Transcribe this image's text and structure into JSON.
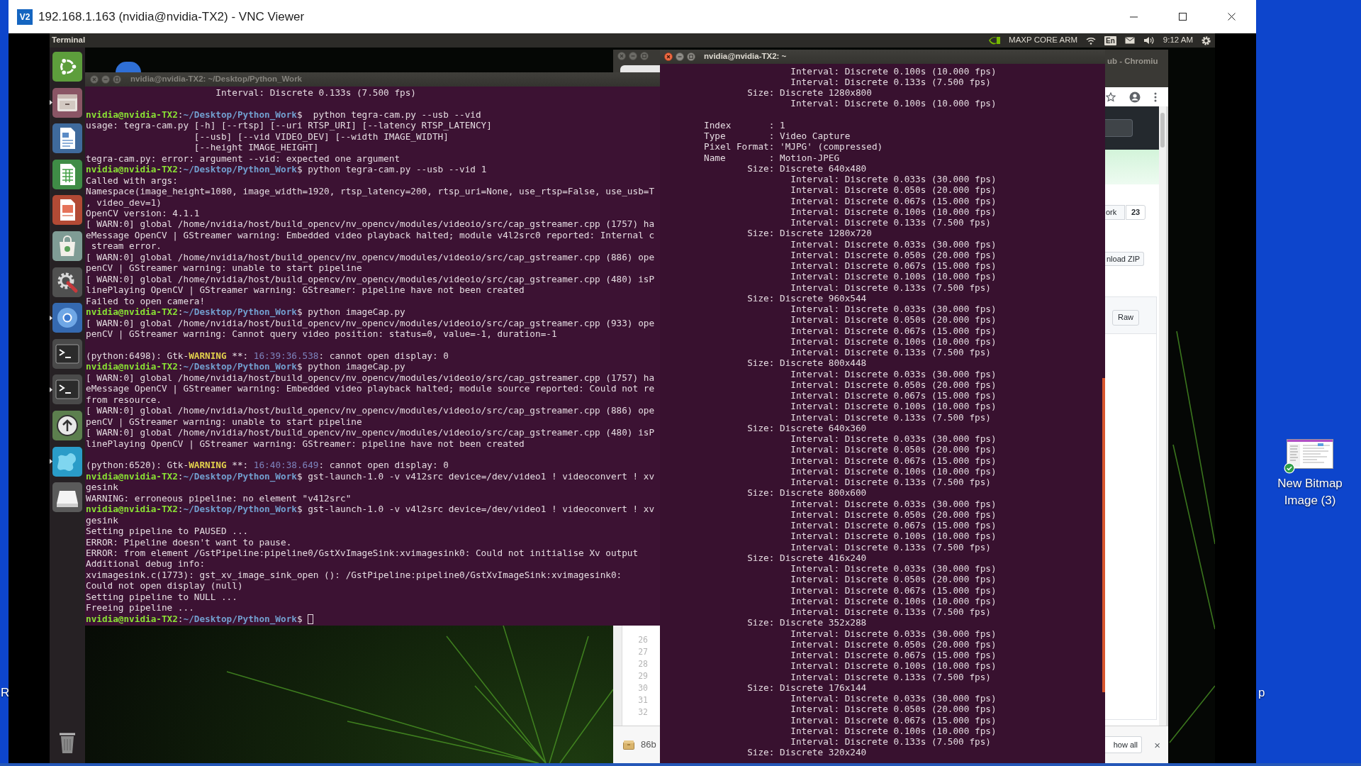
{
  "vnc_window": {
    "logo": "V2",
    "title": "192.168.1.163 (nvidia@nvidia-TX2) - VNC Viewer"
  },
  "desktop": {
    "edge_labels": [
      "R",
      "p"
    ],
    "icons": [
      {
        "label": "New Bitmap Image (3)",
        "synced": true
      }
    ]
  },
  "panel": {
    "app_name": "Terminal",
    "indicator": "MAXP CORE ARM",
    "keyboard": "En",
    "clock": "9:12 AM"
  },
  "launcher": {
    "items": [
      {
        "kind": "home",
        "running": false
      },
      {
        "kind": "files",
        "running": true
      },
      {
        "kind": "document",
        "running": false
      },
      {
        "kind": "spreadsheet",
        "running": false
      },
      {
        "kind": "presentation",
        "running": false
      },
      {
        "kind": "bag",
        "running": false
      },
      {
        "kind": "settings",
        "running": false
      },
      {
        "kind": "browser",
        "running": true
      },
      {
        "kind": "terminal",
        "running": false
      },
      {
        "kind": "terminal",
        "running": true
      },
      {
        "kind": "update",
        "running": false
      },
      {
        "kind": "splash",
        "running": true
      },
      {
        "kind": "drive",
        "running": false
      },
      {
        "kind": "trash",
        "running": false
      }
    ]
  },
  "browser": {
    "active": false,
    "title": "ub - Chromiu",
    "fork_label": "ork",
    "fork_count": "23",
    "download_button": "nload ZIP",
    "raw_button": "Raw",
    "line_numbers": [
      "26",
      "27",
      "28",
      "29",
      "30",
      "31",
      "32"
    ],
    "download_item": "86b",
    "show_all_button": "how all",
    "close_button": "×"
  },
  "terminals": [
    {
      "kind": "log",
      "title": "nvidia@nvidia-TX2: ~/Desktop/Python_Work",
      "active": false,
      "lines": [
        {
          "kind": "out",
          "text": "\t\t\tInterval: Discrete 0.133s (7.500 fps)"
        },
        {
          "kind": "blank"
        },
        {
          "kind": "prompt",
          "user": "nvidia@nvidia-TX2",
          "sep": ":",
          "path": "~/Desktop/Python_Work",
          "command": "$  python tegra-cam.py --usb --vid"
        },
        {
          "kind": "out",
          "text": "usage: tegra-cam.py [-h] [--rtsp] [--uri RTSP_URI] [--latency RTSP_LATENCY]"
        },
        {
          "kind": "out",
          "text": "                    [--usb] [--vid VIDEO_DEV] [--width IMAGE_WIDTH]"
        },
        {
          "kind": "out",
          "text": "                    [--height IMAGE_HEIGHT]"
        },
        {
          "kind": "out",
          "text": "tegra-cam.py: error: argument --vid: expected one argument"
        },
        {
          "kind": "prompt",
          "user": "nvidia@nvidia-TX2",
          "sep": ":",
          "path": "~/Desktop/Python_Work",
          "command": "$ python tegra-cam.py --usb --vid 1"
        },
        {
          "kind": "out",
          "text": "Called with args:"
        },
        {
          "kind": "out",
          "text": "Namespace(image_height=1080, image_width=1920, rtsp_latency=200, rtsp_uri=None, use_rtsp=False, use_usb=T"
        },
        {
          "kind": "out",
          "text": ", video_dev=1)"
        },
        {
          "kind": "out",
          "text": "OpenCV version: 4.1.1"
        },
        {
          "kind": "out",
          "text": "[ WARN:0] global /home/nvidia/host/build_opencv/nv_opencv/modules/videoio/src/cap_gstreamer.cpp (1757) ha"
        },
        {
          "kind": "out",
          "text": "eMessage OpenCV | GStreamer warning: Embedded video playback halted; module v4l2src0 reported: Internal c"
        },
        {
          "kind": "out",
          "text": " stream error."
        },
        {
          "kind": "out",
          "text": "[ WARN:0] global /home/nvidia/host/build_opencv/nv_opencv/modules/videoio/src/cap_gstreamer.cpp (886) ope"
        },
        {
          "kind": "out",
          "text": "penCV | GStreamer warning: unable to start pipeline"
        },
        {
          "kind": "out",
          "text": "[ WARN:0] global /home/nvidia/host/build_opencv/nv_opencv/modules/videoio/src/cap_gstreamer.cpp (480) isP"
        },
        {
          "kind": "out",
          "text": "linePlaying OpenCV | GStreamer warning: GStreamer: pipeline have not been created"
        },
        {
          "kind": "out",
          "text": "Failed to open camera!"
        },
        {
          "kind": "prompt",
          "user": "nvidia@nvidia-TX2",
          "sep": ":",
          "path": "~/Desktop/Python_Work",
          "command": "$ python imageCap.py"
        },
        {
          "kind": "out",
          "text": "[ WARN:0] global /home/nvidia/host/build_opencv/nv_opencv/modules/videoio/src/cap_gstreamer.cpp (933) ope"
        },
        {
          "kind": "out",
          "text": "penCV | GStreamer warning: Cannot query video position: status=0, value=-1, duration=-1"
        },
        {
          "kind": "blank"
        },
        {
          "kind": "gtk",
          "source": "(python:6498): Gtk-",
          "level": "WARNING",
          "marker": " **: ",
          "time": "16:39:36.538",
          "message": ": cannot open display: 0"
        },
        {
          "kind": "prompt",
          "user": "nvidia@nvidia-TX2",
          "sep": ":",
          "path": "~/Desktop/Python_Work",
          "command": "$ python imageCap.py"
        },
        {
          "kind": "out",
          "text": "[ WARN:0] global /home/nvidia/host/build_opencv/nv_opencv/modules/videoio/src/cap_gstreamer.cpp (1757) ha"
        },
        {
          "kind": "out",
          "text": "eMessage OpenCV | GStreamer warning: Embedded video playback halted; module source reported: Could not re"
        },
        {
          "kind": "out",
          "text": "from resource."
        },
        {
          "kind": "out",
          "text": "[ WARN:0] global /home/nvidia/host/build_opencv/nv_opencv/modules/videoio/src/cap_gstreamer.cpp (886) ope"
        },
        {
          "kind": "out",
          "text": "penCV | GStreamer warning: unable to start pipeline"
        },
        {
          "kind": "out",
          "text": "[ WARN:0] global /home/nvidia/host/build_opencv/nv_opencv/modules/videoio/src/cap_gstreamer.cpp (480) isP"
        },
        {
          "kind": "out",
          "text": "linePlaying OpenCV | GStreamer warning: GStreamer: pipeline have not been created"
        },
        {
          "kind": "blank"
        },
        {
          "kind": "gtk",
          "source": "(python:6520): Gtk-",
          "level": "WARNING",
          "marker": " **: ",
          "time": "16:40:38.649",
          "message": ": cannot open display: 0"
        },
        {
          "kind": "prompt",
          "user": "nvidia@nvidia-TX2",
          "sep": ":",
          "path": "~/Desktop/Python_Work",
          "command": "$ gst-launch-1.0 -v v412src device=/dev/video1 ! videoconvert ! xv"
        },
        {
          "kind": "out",
          "text": "gesink"
        },
        {
          "kind": "out",
          "text": "WARNING: erroneous pipeline: no element \"v412src\""
        },
        {
          "kind": "prompt",
          "user": "nvidia@nvidia-TX2",
          "sep": ":",
          "path": "~/Desktop/Python_Work",
          "command": "$ gst-launch-1.0 -v v4l2src device=/dev/video1 ! videoconvert ! xv"
        },
        {
          "kind": "out",
          "text": "gesink"
        },
        {
          "kind": "out",
          "text": "Setting pipeline to PAUSED ..."
        },
        {
          "kind": "out",
          "text": "ERROR: Pipeline doesn't want to pause."
        },
        {
          "kind": "out",
          "text": "ERROR: from element /GstPipeline:pipeline0/GstXvImageSink:xvimagesink0: Could not initialise Xv output"
        },
        {
          "kind": "out",
          "text": "Additional debug info:"
        },
        {
          "kind": "out",
          "text": "xvimagesink.c(1773): gst_xv_image_sink_open (): /GstPipeline:pipeline0/GstXvImageSink:xvimagesink0:"
        },
        {
          "kind": "out",
          "text": "Could not open display (null)"
        },
        {
          "kind": "out",
          "text": "Setting pipeline to NULL ..."
        },
        {
          "kind": "out",
          "text": "Freeing pipeline ..."
        },
        {
          "kind": "prompt",
          "user": "nvidia@nvidia-TX2",
          "sep": ":",
          "path": "~/Desktop/Python_Work",
          "command": "$",
          "cursor": true
        }
      ]
    },
    {
      "kind": "listing",
      "title": "nvidia@nvidia-TX2: ~",
      "active": true,
      "formats": [
        {
          "sizes": [
            {
              "intervals": [
                "Interval: Discrete 0.100s (10.000 fps)",
                "Interval: Discrete 0.133s (7.500 fps)"
              ]
            },
            {
              "size": "Size: Discrete 1280x800",
              "intervals": [
                "Interval: Discrete 0.100s (10.000 fps)"
              ]
            }
          ]
        },
        {
          "fields": [
            "Index       : 1",
            "Type        : Video Capture",
            "Pixel Format: 'MJPG' (compressed)",
            "Name        : Motion-JPEG"
          ],
          "sizes": [
            {
              "size": "Size: Discrete 640x480",
              "intervals": [
                "Interval: Discrete 0.033s (30.000 fps)",
                "Interval: Discrete 0.050s (20.000 fps)",
                "Interval: Discrete 0.067s (15.000 fps)",
                "Interval: Discrete 0.100s (10.000 fps)",
                "Interval: Discrete 0.133s (7.500 fps)"
              ]
            },
            {
              "size": "Size: Discrete 1280x720",
              "intervals": [
                "Interval: Discrete 0.033s (30.000 fps)",
                "Interval: Discrete 0.050s (20.000 fps)",
                "Interval: Discrete 0.067s (15.000 fps)",
                "Interval: Discrete 0.100s (10.000 fps)",
                "Interval: Discrete 0.133s (7.500 fps)"
              ]
            },
            {
              "size": "Size: Discrete 960x544",
              "intervals": [
                "Interval: Discrete 0.033s (30.000 fps)",
                "Interval: Discrete 0.050s (20.000 fps)",
                "Interval: Discrete 0.067s (15.000 fps)",
                "Interval: Discrete 0.100s (10.000 fps)",
                "Interval: Discrete 0.133s (7.500 fps)"
              ]
            },
            {
              "size": "Size: Discrete 800x448",
              "intervals": [
                "Interval: Discrete 0.033s (30.000 fps)",
                "Interval: Discrete 0.050s (20.000 fps)",
                "Interval: Discrete 0.067s (15.000 fps)",
                "Interval: Discrete 0.100s (10.000 fps)",
                "Interval: Discrete 0.133s (7.500 fps)"
              ]
            },
            {
              "size": "Size: Discrete 640x360",
              "intervals": [
                "Interval: Discrete 0.033s (30.000 fps)",
                "Interval: Discrete 0.050s (20.000 fps)",
                "Interval: Discrete 0.067s (15.000 fps)",
                "Interval: Discrete 0.100s (10.000 fps)",
                "Interval: Discrete 0.133s (7.500 fps)"
              ]
            },
            {
              "size": "Size: Discrete 800x600",
              "intervals": [
                "Interval: Discrete 0.033s (30.000 fps)",
                "Interval: Discrete 0.050s (20.000 fps)",
                "Interval: Discrete 0.067s (15.000 fps)",
                "Interval: Discrete 0.100s (10.000 fps)",
                "Interval: Discrete 0.133s (7.500 fps)"
              ]
            },
            {
              "size": "Size: Discrete 416x240",
              "intervals": [
                "Interval: Discrete 0.033s (30.000 fps)",
                "Interval: Discrete 0.050s (20.000 fps)",
                "Interval: Discrete 0.067s (15.000 fps)",
                "Interval: Discrete 0.100s (10.000 fps)",
                "Interval: Discrete 0.133s (7.500 fps)"
              ]
            },
            {
              "size": "Size: Discrete 352x288",
              "intervals": [
                "Interval: Discrete 0.033s (30.000 fps)",
                "Interval: Discrete 0.050s (20.000 fps)",
                "Interval: Discrete 0.067s (15.000 fps)",
                "Interval: Discrete 0.100s (10.000 fps)",
                "Interval: Discrete 0.133s (7.500 fps)"
              ]
            },
            {
              "size": "Size: Discrete 176x144",
              "intervals": [
                "Interval: Discrete 0.033s (30.000 fps)",
                "Interval: Discrete 0.050s (20.000 fps)",
                "Interval: Discrete 0.067s (15.000 fps)",
                "Interval: Discrete 0.100s (10.000 fps)",
                "Interval: Discrete 0.133s (7.500 fps)"
              ]
            },
            {
              "size": "Size: Discrete 320x240"
            }
          ]
        }
      ]
    }
  ]
}
